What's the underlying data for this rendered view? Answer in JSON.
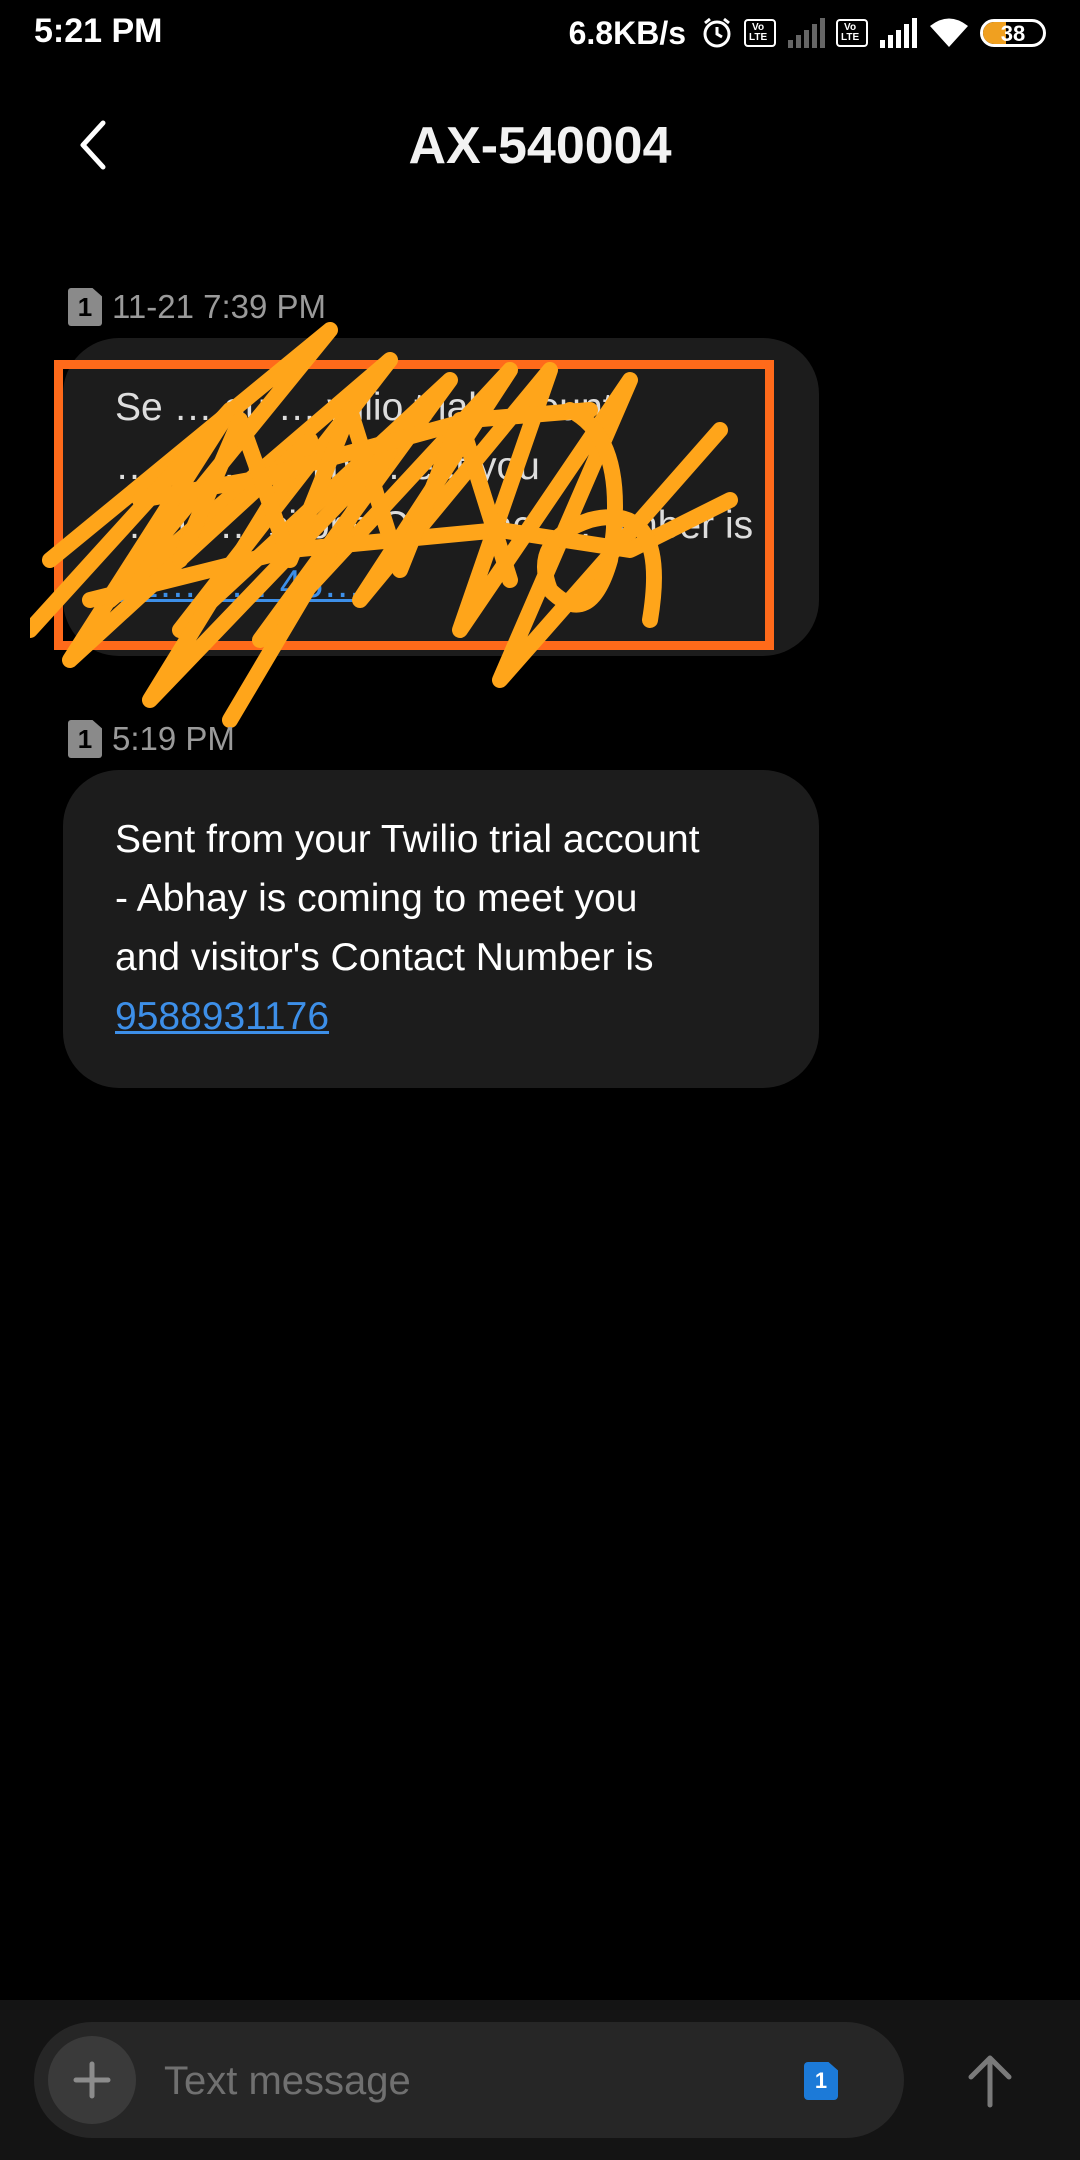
{
  "status_bar": {
    "time": "5:21 PM",
    "net_speed": "6.8KB/s",
    "volte_label": "Vo\nLTE",
    "battery_level": "38",
    "icons": [
      "alarm-icon",
      "volte-icon",
      "signal-icon",
      "volte-icon",
      "signal-icon",
      "wifi-icon",
      "battery-icon"
    ]
  },
  "header": {
    "title": "AX-540004",
    "back_icon": "chevron-left-icon"
  },
  "messages": [
    {
      "sim": "1",
      "timestamp": "11-21 7:39 PM",
      "text": "Sent from your Twilio trial account - Abhay is coming to meet you and visitor's Contact Number is",
      "visible_text": "Se … ou … wilio trial … ount\n… u … comin … eet you\n… nd … sitor's Co … act … umber is",
      "number": "81… 9… 45…",
      "redacted": true
    },
    {
      "sim": "1",
      "timestamp": "5:19 PM",
      "text": "Sent from your Twilio trial account - Abhay is coming to meet you and visitor's Contact Number is",
      "line1": "Sent from your Twilio trial account",
      "line2": "- Abhay is coming to meet you",
      "line3": "and visitor's Contact Number is",
      "number": "9588931176",
      "redacted": false
    }
  ],
  "composer": {
    "placeholder": "Text message",
    "sim": "1",
    "add_icon": "plus-icon",
    "send_icon": "arrow-up-icon"
  },
  "colors": {
    "background": "#000000",
    "bubble": "#1c1c1c",
    "link": "#3d8fe8",
    "redaction_box": "#ff6a1a",
    "scribble": "#ffa51a",
    "sim_select": "#1c7ad8"
  }
}
